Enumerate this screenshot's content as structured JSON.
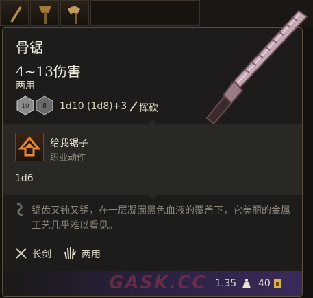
{
  "item": {
    "name": "骨锯",
    "damage_range": "4~13伤害",
    "handedness": "两用",
    "damage_formula": "1d10 (1d8)+3",
    "damage_type": "挥砍"
  },
  "action": {
    "name": "给我锯子",
    "type": "职业动作",
    "dice": "1d6"
  },
  "lore": "锯齿又钝又锈，在一层凝固黑色血液的覆盖下，它美丽的金属工艺几乎难以看见。",
  "proficiencies": [
    {
      "label": "长剑",
      "icon": "crossed-swords-icon"
    },
    {
      "label": "两用",
      "icon": "hand-icon"
    }
  ],
  "footer": {
    "weight": "1.35",
    "value": "40"
  },
  "watermark": "GASK.CC",
  "colors": {
    "border": "#5b4e3c",
    "panel": "#1b1917",
    "accent_orange": "#e08a3c",
    "footer_purple": "#3a2a5a"
  }
}
